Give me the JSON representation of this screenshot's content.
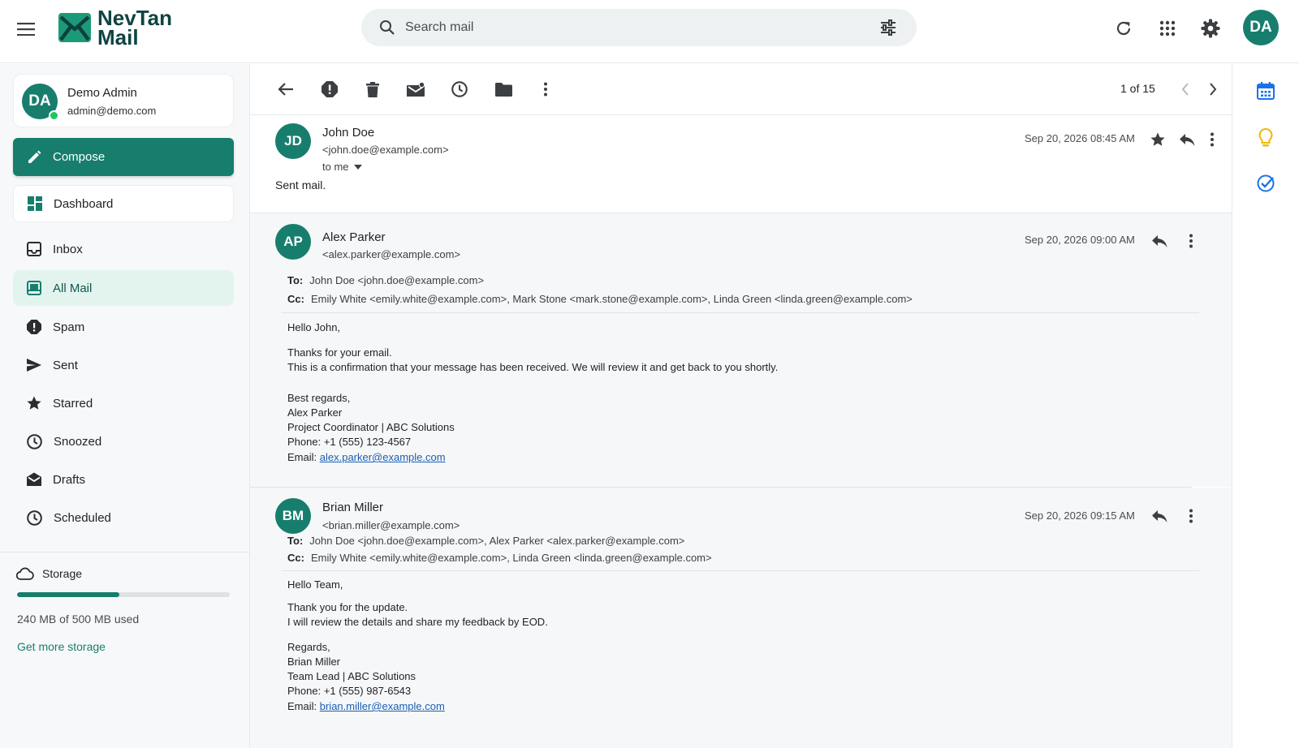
{
  "app": {
    "name_line1": "NevTan",
    "name_line2": "Mail"
  },
  "search": {
    "placeholder": "Search mail"
  },
  "header": {
    "avatar_initials": "DA"
  },
  "profile": {
    "initials": "DA",
    "name": "Demo Admin",
    "email": "admin@demo.com"
  },
  "sidebar": {
    "compose_label": "Compose",
    "dashboard_label": "Dashboard",
    "items": [
      {
        "label": "Inbox",
        "icon": "inbox-icon"
      },
      {
        "label": "All Mail",
        "icon": "all-mail-icon",
        "active": true
      },
      {
        "label": "Spam",
        "icon": "spam-icon"
      },
      {
        "label": "Sent",
        "icon": "sent-icon"
      },
      {
        "label": "Starred",
        "icon": "star-icon"
      },
      {
        "label": "Snoozed",
        "icon": "clock-icon"
      },
      {
        "label": "Drafts",
        "icon": "drafts-icon"
      },
      {
        "label": "Scheduled",
        "icon": "scheduled-icon"
      }
    ],
    "storage": {
      "title": "Storage",
      "used_text": "240 MB of 500 MB used",
      "used_fraction": 0.48,
      "link": "Get more storage"
    }
  },
  "toolbar": {
    "pager": "1 of 15"
  },
  "colors": {
    "accent": "#177e6d",
    "active_bg": "#e3f3ee",
    "link": "#1a5fb4",
    "online": "#22c55e"
  },
  "messages": [
    {
      "initials": "JD",
      "name": "John Doe",
      "email": "<john.doe@example.com>",
      "to_me": "to me",
      "date": "Sep 20, 2026 08:45 AM",
      "snippet": "Sent mail."
    },
    {
      "initials": "AP",
      "name": "Alex Parker",
      "email": "<alex.parker@example.com>",
      "date": "Sep 20, 2026 09:00 AM",
      "to_label": "To:",
      "to": "John Doe <john.doe@example.com>",
      "cc_label": "Cc:",
      "cc": "Emily White <emily.white@example.com>, Mark Stone <mark.stone@example.com>, Linda Green <linda.green@example.com>",
      "body": [
        "Hello John,",
        "Thanks for your email.",
        "This is a confirmation that your message has been received. We will review it and get back to you shortly.",
        "Best regards,",
        "Alex Parker",
        "Project Coordinator | ABC Solutions",
        "Phone: +1 (555) 123-4567"
      ],
      "email_label": "Email:",
      "email_link": "alex.parker@example.com"
    },
    {
      "initials": "BM",
      "name": "Brian Miller",
      "email": "<brian.miller@example.com>",
      "date": "Sep 20, 2026 09:15 AM",
      "to_label": "To:",
      "to": "John Doe <john.doe@example.com>, Alex Parker <alex.parker@example.com>",
      "cc_label": "Cc:",
      "cc": "Emily White <emily.white@example.com>, Linda Green <linda.green@example.com>",
      "body": [
        "Hello Team,",
        "Thank you for the update.",
        "I will review the details and share my feedback by EOD.",
        "Regards,",
        "Brian Miller",
        "Team Lead | ABC Solutions",
        "Phone: +1 (555) 987-6543"
      ],
      "email_label": "Email:",
      "email_link": "brian.miller@example.com"
    }
  ]
}
